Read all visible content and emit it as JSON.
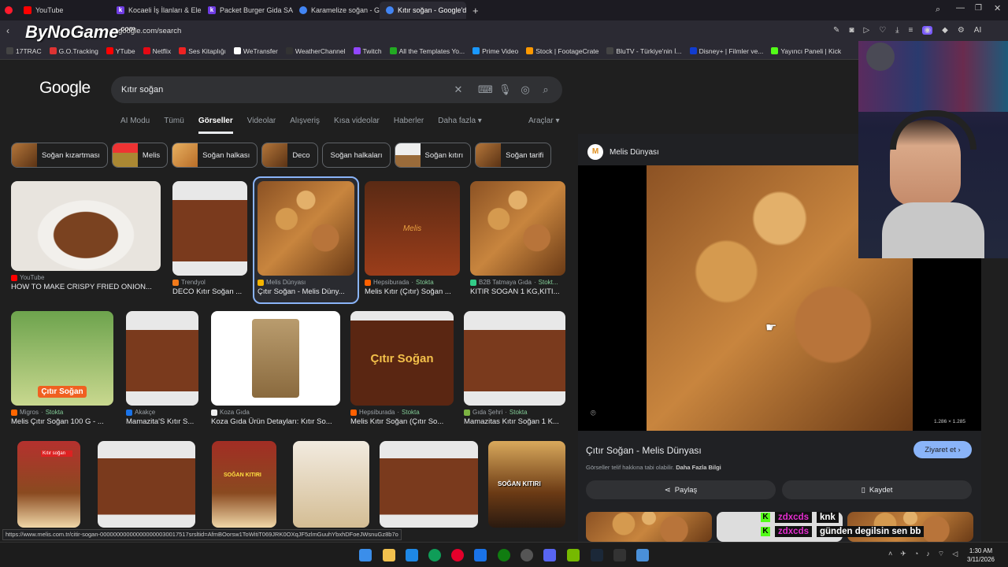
{
  "tabs": [
    {
      "label": "YouTube",
      "color": "#ff0000",
      "active": false
    },
    {
      "label": "Kocaeli İş İlanları & Eleman",
      "color": "#6f3ce3",
      "active": false
    },
    {
      "label": "Packet Burger Gida SAnay",
      "color": "#6f3ce3",
      "active": false
    },
    {
      "label": "Karamelize soğan - Google",
      "color": "#4285f4",
      "active": false
    },
    {
      "label": "Kıtır soğan - Google'da Ar",
      "color": "#4285f4",
      "active": true
    }
  ],
  "address": {
    "url": "google.com/search",
    "watermark": "ByNoGame",
    "watermark_sup": ".com"
  },
  "bookmarks": [
    "17TRAC",
    "G.O.Tracking",
    "YTube",
    "Netflix",
    "Ses Kitaplığı",
    "WeTransfer",
    "WeatherChannel",
    "Twitch",
    "All the Templates Yo...",
    "Prime Video",
    "Stock | FootageCrate",
    "BluTV - Türkiye'nin İ...",
    "Disney+ | Filmler ve...",
    "Yayıncı Paneli | Kick"
  ],
  "google": {
    "logo": "Google",
    "query": "Kıtır soğan",
    "nav": [
      "AI Modu",
      "Tümü",
      "Görseller",
      "Videolar",
      "Alışveriş",
      "Kısa videolar",
      "Haberler",
      "Daha fazla ▾"
    ],
    "tools": "Araçlar ▾",
    "chips": [
      "Soğan kızartması",
      "Melis",
      "Soğan halkası",
      "Deco",
      "Soğan halkaları",
      "Soğan kıtırı",
      "Soğan tarifi"
    ]
  },
  "results_row1": [
    {
      "source": "YouTube",
      "title": "HOW TO MAKE CRISPY FRIED ONION...",
      "stock": ""
    },
    {
      "source": "Trendyol",
      "title": "DECO Kıtır Soğan ...",
      "stock": ""
    },
    {
      "source": "Melis Dünyası",
      "title": "Çıtır Soğan - Melis Düny...",
      "stock": ""
    },
    {
      "source": "Hepsiburada",
      "title": "Melis Kıtır (Çıtır) Soğan ...",
      "stock": "Stokta"
    },
    {
      "source": "B2B Tatmaya Gıda",
      "title": "KITIR SOGAN 1 KG,KITI...",
      "stock": "Stokt..."
    }
  ],
  "results_row2": [
    {
      "source": "Migros",
      "title": "Melis Çıtır Soğan 100 G - ...",
      "stock": "Stokta"
    },
    {
      "source": "Akakçe",
      "title": "Mamazita'S Kıtır S...",
      "stock": ""
    },
    {
      "source": "Koza Gıda",
      "title": "Koza Gıda Ürün Detayları: Kıtır So...",
      "stock": ""
    },
    {
      "source": "Hepsiburada",
      "title": "Melis Kıtır Soğan (Çıtır So...",
      "stock": "Stokta"
    },
    {
      "source": "Gıda Şehri",
      "title": "Mamazitas Kıtır Soğan 1 K...",
      "stock": "Stokta"
    }
  ],
  "overlay_text": {
    "r2_1": "Çıtır Soğan",
    "r2_4": "Çıtır Soğan",
    "r3_1": "Kıtır soğan",
    "r3_3": "SOĞAN KITIRI",
    "r3_6": "SOĞAN KITIRI",
    "melis": "Melis"
  },
  "panel": {
    "site": "Melis Dünyası",
    "title": "Çıtır Soğan - Melis Dünyası",
    "visit": "Ziyaret et ›",
    "copyright": "Görseller telif hakkına tabi olabilir.",
    "more_info": "Daha Fazla Bilgi",
    "share": "Paylaş",
    "save": "Kaydet",
    "dimensions": "1.286 × 1.285"
  },
  "chat": [
    {
      "user": "zdxcds",
      "msg": "knk"
    },
    {
      "user": "zdxcds",
      "msg": "günden degilsin sen bb"
    }
  ],
  "status_url": "https://www.melis.com.tr/citir-sogan-000000000000000000030017517srsltid=AfmBOorsw1ToWitiT069JRK0OXqJF5zlmGuuhYbxhDFoeJWsnuGz8b7o",
  "clock": {
    "time": "1:30 AM",
    "date": "3/11/2026"
  }
}
